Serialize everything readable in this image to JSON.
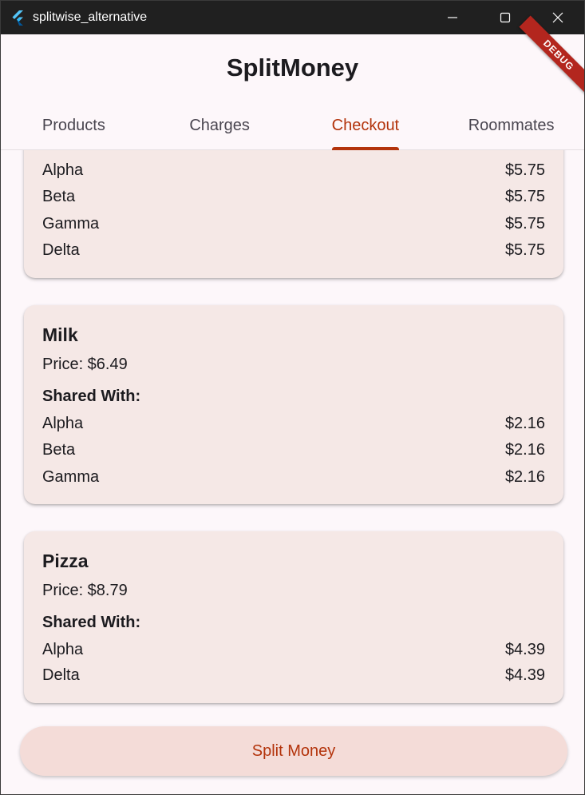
{
  "window": {
    "title": "splitwise_alternative",
    "debug_label": "DEBUG"
  },
  "appbar": {
    "title": "SplitMoney"
  },
  "tabs": [
    {
      "label": "Products",
      "active": false
    },
    {
      "label": "Charges",
      "active": false
    },
    {
      "label": "Checkout",
      "active": true
    },
    {
      "label": "Roommates",
      "active": false
    }
  ],
  "cards": [
    {
      "title": "",
      "price": "",
      "shared_label": "",
      "rows": [
        {
          "name": "Alpha",
          "amount": "$5.75"
        },
        {
          "name": "Beta",
          "amount": "$5.75"
        },
        {
          "name": "Gamma",
          "amount": "$5.75"
        },
        {
          "name": "Delta",
          "amount": "$5.75"
        }
      ]
    },
    {
      "title": "Milk",
      "price": "Price: $6.49",
      "shared_label": "Shared With:",
      "rows": [
        {
          "name": "Alpha",
          "amount": "$2.16"
        },
        {
          "name": "Beta",
          "amount": "$2.16"
        },
        {
          "name": "Gamma",
          "amount": "$2.16"
        }
      ]
    },
    {
      "title": "Pizza",
      "price": "Price: $8.79",
      "shared_label": "Shared With:",
      "rows": [
        {
          "name": "Alpha",
          "amount": "$4.39"
        },
        {
          "name": "Delta",
          "amount": "$4.39"
        }
      ]
    }
  ],
  "split_button": {
    "label": "Split Money"
  },
  "colors": {
    "accent": "#b3330b",
    "card_bg": "#f5e8e6",
    "page_bg": "#fdf7fa",
    "titlebar_bg": "#202020"
  }
}
